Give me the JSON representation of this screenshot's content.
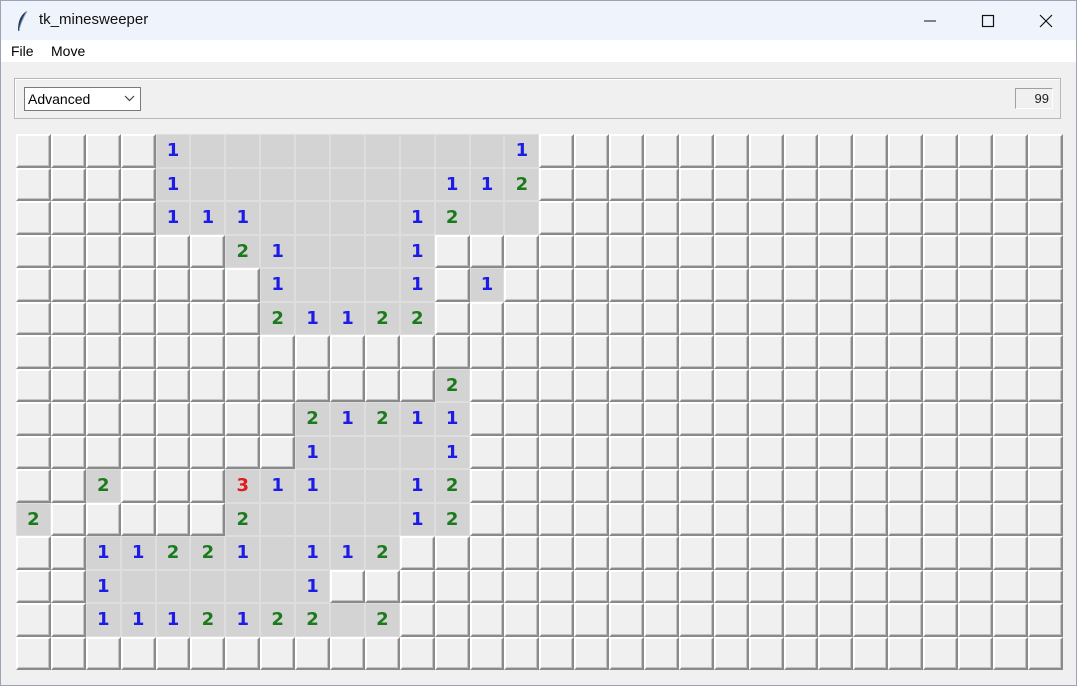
{
  "window": {
    "title": "tk_minesweeper",
    "icons": {
      "app": "feather-icon",
      "minimize": "minimize-icon",
      "maximize": "maximize-icon",
      "close": "close-icon"
    }
  },
  "menu": {
    "items": [
      "File",
      "Move"
    ]
  },
  "toolbar": {
    "difficulty": {
      "selected": "Advanced",
      "icon": "chevron-down-icon"
    },
    "mine_counter": "99"
  },
  "colors": {
    "number_1": "#1c1ce6",
    "number_2": "#1b7a1b",
    "number_3": "#e01c1c",
    "revealed_cell": "#d3d3d3",
    "covered_cell": "#f0f0f0"
  },
  "board": {
    "columns": 30,
    "rows": [
      "....1.........1...............",
      "....1.......112...............",
      "....111....12..................",
      "......21...1...................",
      ".......1...1.1.................",
      ".......21122....................",
      "..............................",
      "............2.................",
      "........21211.................",
      "........1...1.................",
      "..2...311..12.................",
      "2.....2....12.................",
      "..11221.112...................",
      "..1.....1.....................",
      "..1112122.2...................",
      ".............................."
    ],
    "revealed": [
      [
        4,
        5,
        6,
        7,
        8,
        9,
        10,
        11,
        12,
        13,
        14
      ],
      [
        4,
        5,
        6,
        7,
        8,
        9,
        10,
        11,
        12,
        13,
        14
      ],
      [
        4,
        5,
        6,
        7,
        8,
        9,
        10,
        11,
        12,
        13,
        14
      ],
      [
        6,
        7,
        8,
        9,
        10,
        11
      ],
      [
        7,
        8,
        9,
        10,
        11,
        13
      ],
      [
        7,
        8,
        9,
        10,
        11
      ],
      [],
      [
        12
      ],
      [
        8,
        9,
        10,
        11,
        12
      ],
      [
        8,
        9,
        10,
        11,
        12
      ],
      [
        2,
        6,
        7,
        8,
        9,
        10,
        11,
        12
      ],
      [
        0,
        6,
        7,
        8,
        9,
        10,
        11
      ],
      [
        2,
        3,
        4,
        5,
        6,
        7,
        8,
        9,
        10
      ],
      [
        2,
        3,
        4,
        5,
        6,
        7,
        8
      ],
      [
        2,
        3,
        4,
        5,
        6,
        7,
        8,
        9,
        10
      ],
      []
    ]
  }
}
